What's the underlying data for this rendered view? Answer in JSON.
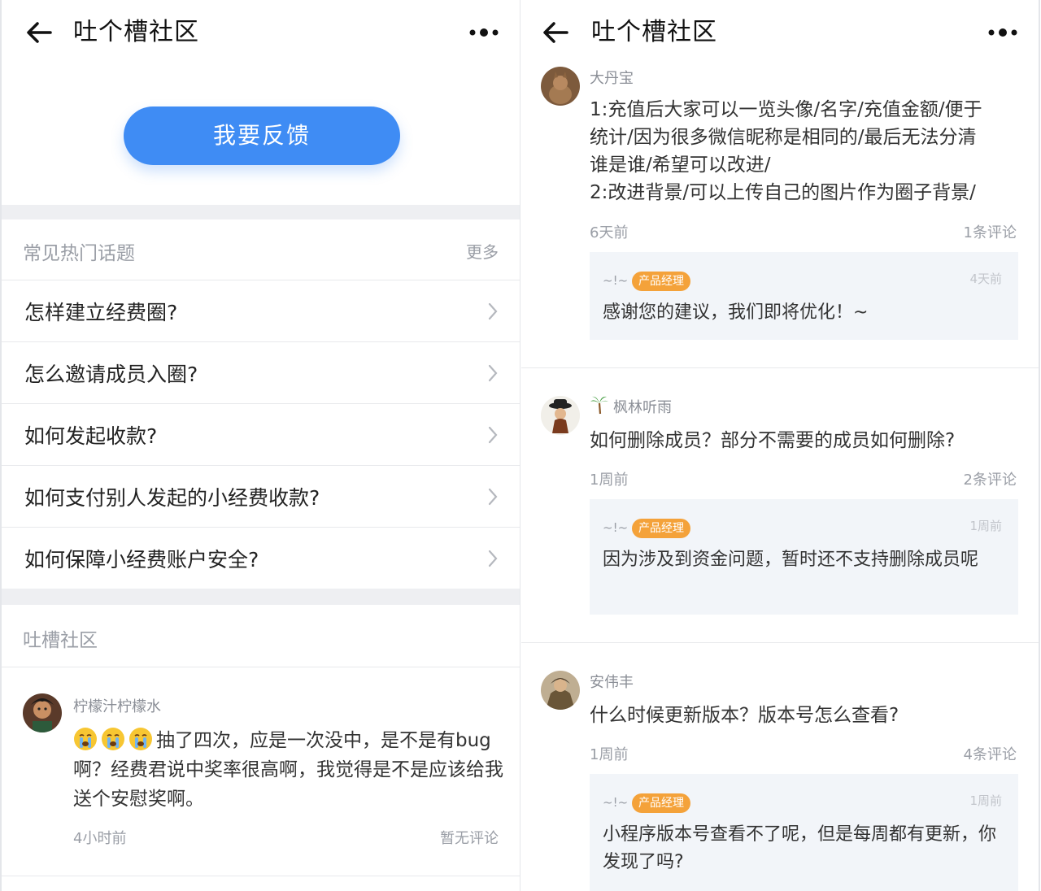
{
  "left": {
    "title": "吐个槽社区",
    "feedback_label": "我要反馈",
    "faq": {
      "heading": "常见热门话题",
      "more": "更多",
      "items": [
        "怎样建立经费圈?",
        "怎么邀请成员入圈?",
        "如何发起收款?",
        "如何支付别人发起的小经费收款?",
        "如何保障小经费账户安全?"
      ]
    },
    "community": {
      "heading": "吐槽社区",
      "post": {
        "author": "柠檬汁柠檬水",
        "text": "抽了四次，应是一次没中，是不是有bug啊？经费君说中奖率很高啊，我觉得是不是应该给我送个安慰奖啊。",
        "time": "4小时前",
        "comments": "暂无评论"
      }
    }
  },
  "right": {
    "title": "吐个槽社区",
    "posts": [
      {
        "author": "大丹宝",
        "text_lines": [
          "1:充值后大家可以一览头像/名字/充值金额/便于",
          "统计/因为很多微信昵称是相同的/最后无法分清",
          "谁是谁/希望可以改进/",
          "2:改进背景/可以上传自己的图片作为圈子背景/"
        ],
        "time": "6天前",
        "comments": "1条评论",
        "reply": {
          "sig": "~!~",
          "badge": "产品经理",
          "time": "4天前",
          "text": "感谢您的建议，我们即将优化！~"
        }
      },
      {
        "author": "枫林听雨",
        "text_lines": [
          "如何删除成员？部分不需要的成员如何删除?"
        ],
        "time": "1周前",
        "comments": "2条评论",
        "reply": {
          "sig": "~!~",
          "badge": "产品经理",
          "time": "1周前",
          "text": "因为涉及到资金问题，暂时还不支持删除成员呢"
        }
      },
      {
        "author": "安伟丰",
        "text_lines": [
          "什么时候更新版本？版本号怎么查看?"
        ],
        "time": "1周前",
        "comments": "4条评论",
        "reply": {
          "sig": "~!~",
          "badge": "产品经理",
          "time": "1周前",
          "text": "小程序版本号查看不了呢，但是每周都有更新，你发现了吗?"
        }
      }
    ]
  },
  "colors": {
    "accent": "#3f8cf4",
    "badge": "#f4a23a",
    "reply_bg": "#f2f5f9"
  },
  "icons": [
    "back-arrow-icon",
    "more-dots-icon",
    "chevron-right-icon",
    "palm-tree-icon",
    "crying-emoji-icon"
  ]
}
